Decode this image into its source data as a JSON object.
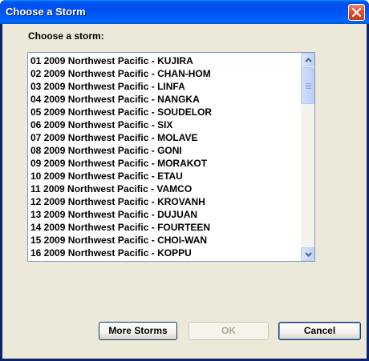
{
  "window": {
    "title": "Choose a Storm"
  },
  "dialog": {
    "prompt": "Choose a storm:",
    "storms": [
      "01 2009 Northwest Pacific - KUJIRA",
      "02 2009 Northwest Pacific - CHAN-HOM",
      "03 2009 Northwest Pacific - LINFA",
      "04 2009 Northwest Pacific - NANGKA",
      "05 2009 Northwest Pacific - SOUDELOR",
      "06 2009 Northwest Pacific - SIX",
      "07 2009 Northwest Pacific - MOLAVE",
      "08 2009 Northwest Pacific - GONI",
      "09 2009 Northwest Pacific - MORAKOT",
      "10 2009 Northwest Pacific - ETAU",
      "11 2009 Northwest Pacific - VAMCO",
      "12 2009 Northwest Pacific - KROVANH",
      "13 2009 Northwest Pacific - DUJUAN",
      "14 2009 Northwest Pacific - FOURTEEN",
      "15 2009 Northwest Pacific - CHOI-WAN",
      "16 2009 Northwest Pacific - KOPPU"
    ],
    "buttons": {
      "more_storms": "More Storms",
      "ok": "OK",
      "cancel": "Cancel"
    }
  },
  "icons": {
    "close": "close-icon",
    "scroll_up": "scroll-up-arrow-icon",
    "scroll_down": "scroll-down-arrow-icon"
  }
}
